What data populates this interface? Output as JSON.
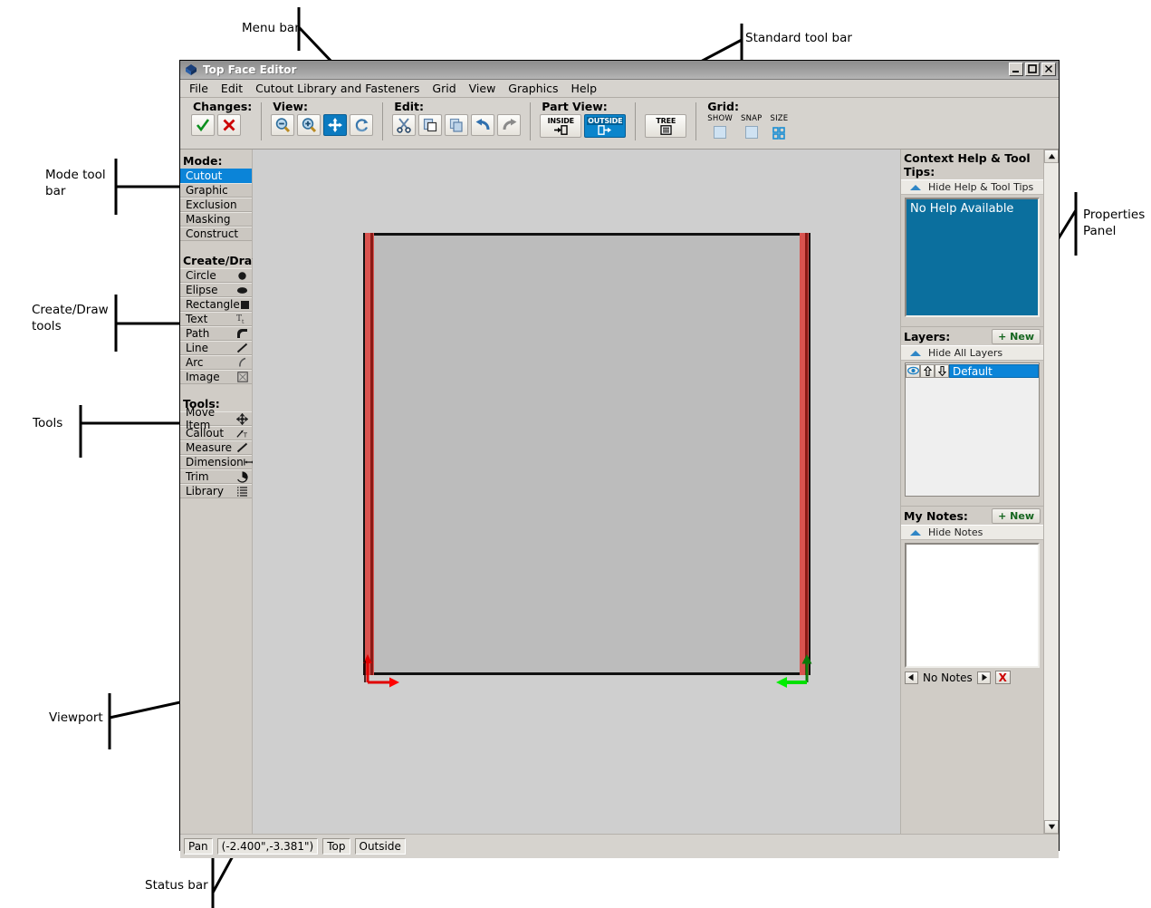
{
  "annotations": [
    {
      "id": "menu-bar",
      "text": "Menu bar"
    },
    {
      "id": "standard-tool-bar",
      "text": "Standard tool bar"
    },
    {
      "id": "mode-tool-bar",
      "text": "Mode tool\nbar"
    },
    {
      "id": "create-draw-tools",
      "text": "Create/Draw\ntools"
    },
    {
      "id": "tools",
      "text": "Tools"
    },
    {
      "id": "viewport",
      "text": "Viewport"
    },
    {
      "id": "status-bar",
      "text": "Status bar"
    },
    {
      "id": "properties-panel",
      "text": "Properties\nPanel"
    }
  ],
  "window": {
    "title": "Top Face Editor",
    "buttons": {
      "minimize": "_",
      "maximize": "❐",
      "close": "✕"
    }
  },
  "menu": {
    "items": [
      "File",
      "Edit",
      "Cutout Library and Fasteners",
      "Grid",
      "View",
      "Graphics",
      "Help"
    ]
  },
  "toolbar": {
    "groups": [
      {
        "label": "Changes:",
        "buttons": [
          {
            "name": "accept-changes-button",
            "icon": "check-icon"
          },
          {
            "name": "reject-changes-button",
            "icon": "cross-icon"
          }
        ]
      },
      {
        "label": "View:",
        "buttons": [
          {
            "name": "zoom-out-button",
            "icon": "zoom-out-icon"
          },
          {
            "name": "zoom-in-button",
            "icon": "zoom-in-icon"
          },
          {
            "name": "pan-button",
            "icon": "pan-icon",
            "active": true
          },
          {
            "name": "refresh-view-button",
            "icon": "refresh-icon"
          }
        ]
      },
      {
        "label": "Edit:",
        "buttons": [
          {
            "name": "cut-button",
            "icon": "scissors-icon"
          },
          {
            "name": "paste-button",
            "icon": "paste-icon"
          },
          {
            "name": "copy-button",
            "icon": "copy-icon"
          },
          {
            "name": "undo-button",
            "icon": "undo-arrow-icon"
          },
          {
            "name": "redo-button",
            "icon": "redo-arrow-icon"
          }
        ]
      }
    ],
    "part_view": {
      "label": "Part View:",
      "inside": "INSIDE",
      "outside": "OUTSIDE",
      "tree": "TREE",
      "selected": "OUTSIDE"
    },
    "grid": {
      "label": "Grid:",
      "show": "SHOW",
      "snap": "SNAP",
      "size": "SIZE"
    }
  },
  "left_rail": {
    "mode": {
      "heading": "Mode:",
      "items": [
        {
          "label": "Cutout",
          "selected": true
        },
        {
          "label": "Graphic",
          "selected": false
        },
        {
          "label": "Exclusion",
          "selected": false
        },
        {
          "label": "Masking",
          "selected": false
        },
        {
          "label": "Construct",
          "selected": false
        }
      ]
    },
    "create_draw": {
      "heading": "Create/Draw:",
      "items": [
        {
          "label": "Circle",
          "icon": "filled-circle-icon"
        },
        {
          "label": "Elipse",
          "icon": "filled-ellipse-icon"
        },
        {
          "label": "Rectangle",
          "icon": "filled-square-icon"
        },
        {
          "label": "Text",
          "icon": "text-tool-icon"
        },
        {
          "label": "Path",
          "icon": "path-corner-icon"
        },
        {
          "label": "Line",
          "icon": "diagonal-line-icon"
        },
        {
          "label": "Arc",
          "icon": "arc-icon"
        },
        {
          "label": "Image",
          "icon": "image-placeholder-icon"
        }
      ]
    },
    "tools": {
      "heading": "Tools:",
      "items": [
        {
          "label": "Move Item",
          "icon": "move-arrows-icon"
        },
        {
          "label": "Callout",
          "icon": "callout-icon"
        },
        {
          "label": "Measure",
          "icon": "measure-icon"
        },
        {
          "label": "Dimension",
          "icon": "dimension-icon"
        },
        {
          "label": "Trim",
          "icon": "trim-icon"
        },
        {
          "label": "Library",
          "icon": "library-list-icon"
        }
      ]
    }
  },
  "right_panel": {
    "help": {
      "title": "Context Help & Tool Tips:",
      "toggle": "Hide Help & Tool Tips",
      "content": "No Help Available"
    },
    "layers": {
      "title": "Layers:",
      "new_label": "+ New",
      "toggle": "Hide All Layers",
      "rows": [
        {
          "name": "Default",
          "selected": true
        }
      ]
    },
    "notes": {
      "title": "My Notes:",
      "new_label": "+ New",
      "toggle": "Hide Notes",
      "content": "",
      "status": "No Notes",
      "prev": "◀",
      "next": "▶",
      "delete": "X"
    }
  },
  "status_bar": {
    "mode": "Pan",
    "coordinates": "(-2.400\",-3.381\")",
    "view": "Top",
    "side": "Outside"
  },
  "colors": {
    "accent_blue": "#0b84d8",
    "help_blue": "#0b6f9e",
    "part_fill": "#bcbcbc",
    "red_band": "#d9534f",
    "origin_red": "#ff0000",
    "origin_green": "#00dd00",
    "window_chrome": "#d6d3ce"
  }
}
